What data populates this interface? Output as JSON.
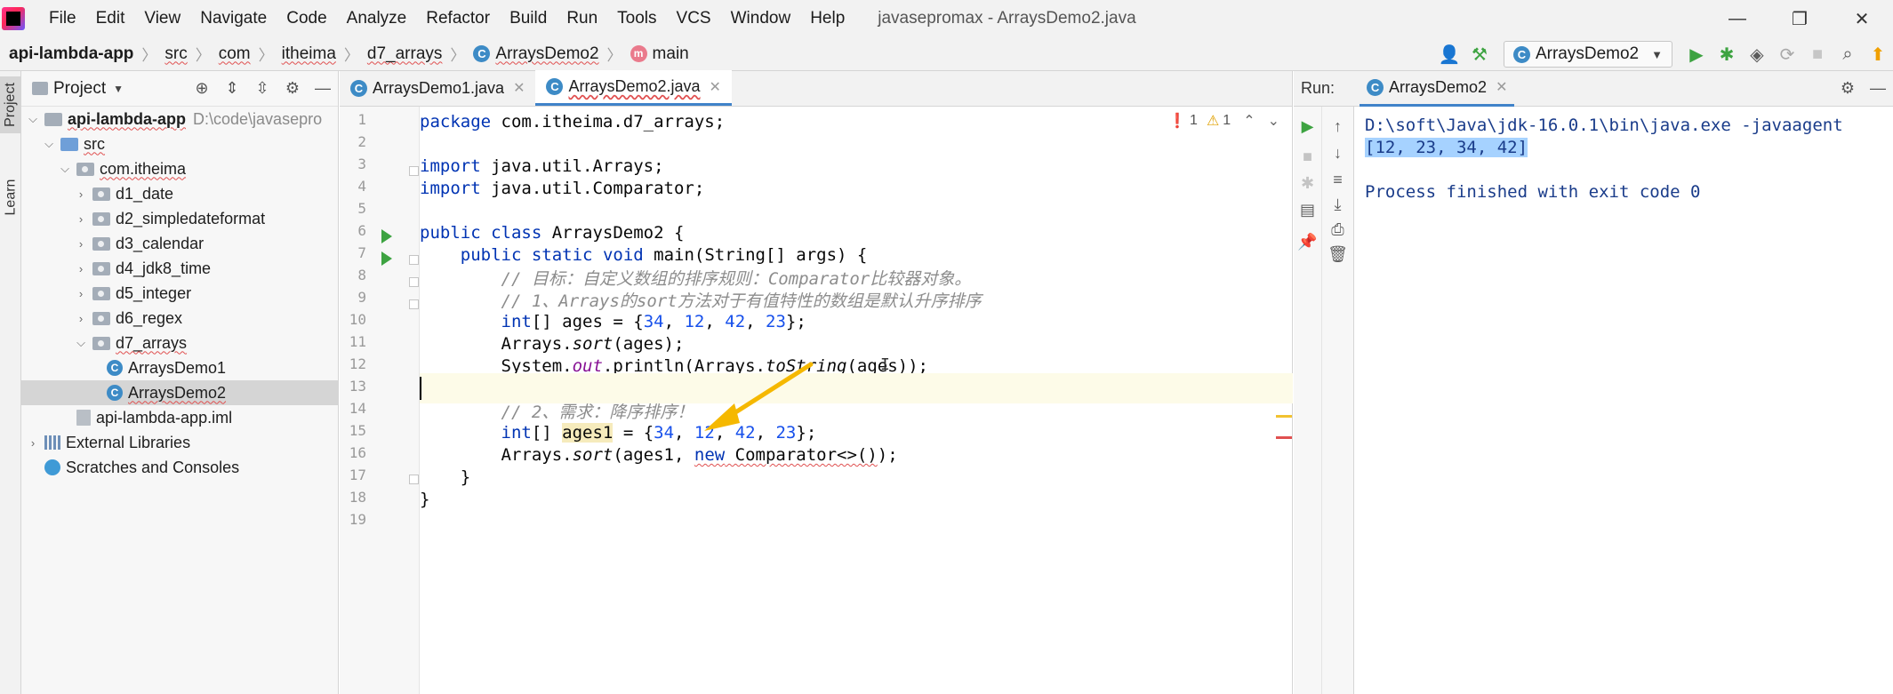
{
  "menu": {
    "items": [
      "File",
      "Edit",
      "View",
      "Navigate",
      "Code",
      "Analyze",
      "Refactor",
      "Build",
      "Run",
      "Tools",
      "VCS",
      "Window",
      "Help"
    ],
    "window_title": "javasepromax - ArraysDemo2.java"
  },
  "nav": {
    "crumbs": [
      "api-lambda-app",
      "src",
      "com",
      "itheima",
      "d7_arrays",
      "ArraysDemo2",
      "main"
    ],
    "run_config": "ArraysDemo2"
  },
  "stripe": {
    "project_tab": "Project",
    "learn_tab": "Learn"
  },
  "project": {
    "title": "Project",
    "tree": [
      {
        "label": "api-lambda-app",
        "extra": "D:\\code\\javasepro"
      },
      {
        "label": "src"
      },
      {
        "label": "com.itheima"
      },
      {
        "label": "d1_date"
      },
      {
        "label": "d2_simpledateformat"
      },
      {
        "label": "d3_calendar"
      },
      {
        "label": "d4_jdk8_time"
      },
      {
        "label": "d5_integer"
      },
      {
        "label": "d6_regex"
      },
      {
        "label": "d7_arrays"
      },
      {
        "label": "ArraysDemo1"
      },
      {
        "label": "ArraysDemo2"
      },
      {
        "label": "api-lambda-app.iml"
      },
      {
        "label": "External Libraries"
      },
      {
        "label": "Scratches and Consoles"
      }
    ]
  },
  "editor": {
    "tabs": [
      "ArraysDemo1.java",
      "ArraysDemo2.java"
    ],
    "inspections": {
      "errors": "1",
      "warnings": "1"
    },
    "line_numbers": [
      "1",
      "2",
      "3",
      "4",
      "5",
      "6",
      "7",
      "8",
      "9",
      "10",
      "11",
      "12",
      "13",
      "14",
      "15",
      "16",
      "17",
      "18",
      "19"
    ],
    "lines": [
      "package com.itheima.d7_arrays;",
      "",
      "import java.util.Arrays;",
      "import java.util.Comparator;",
      "",
      "public class ArraysDemo2 {",
      "    public static void main(String[] args) {",
      "        // 目标：自定义数组的排序规则：Comparator比较器对象。",
      "        // 1、Arrays的sort方法对于有值特性的数组是默认升序排序",
      "        int[] ages = {34, 12, 42, 23};",
      "        Arrays.sort(ages);",
      "        System.out.println(Arrays.toString(ages));",
      "",
      "        // 2、需求：降序排序！",
      "        int[] ages1 = {34, 12, 42, 23};",
      "        Arrays.sort(ages1, new Comparator<>());",
      "    }",
      "}",
      ""
    ]
  },
  "run": {
    "label": "Run:",
    "tab": "ArraysDemo2",
    "console": [
      "D:\\soft\\Java\\jdk-16.0.1\\bin\\java.exe -javaagent",
      "[12, 23, 34, 42]",
      "",
      "Process finished with exit code 0"
    ]
  },
  "colors": {
    "keyword": "#0033b3",
    "number": "#1750eb",
    "comment": "#8c8c8c",
    "console_text": "#1a3c8a",
    "selection": "#a6d2ff",
    "annotation_arrow": "#f5b800",
    "run_green": "#3da341",
    "tab_accent": "#4083c9"
  }
}
